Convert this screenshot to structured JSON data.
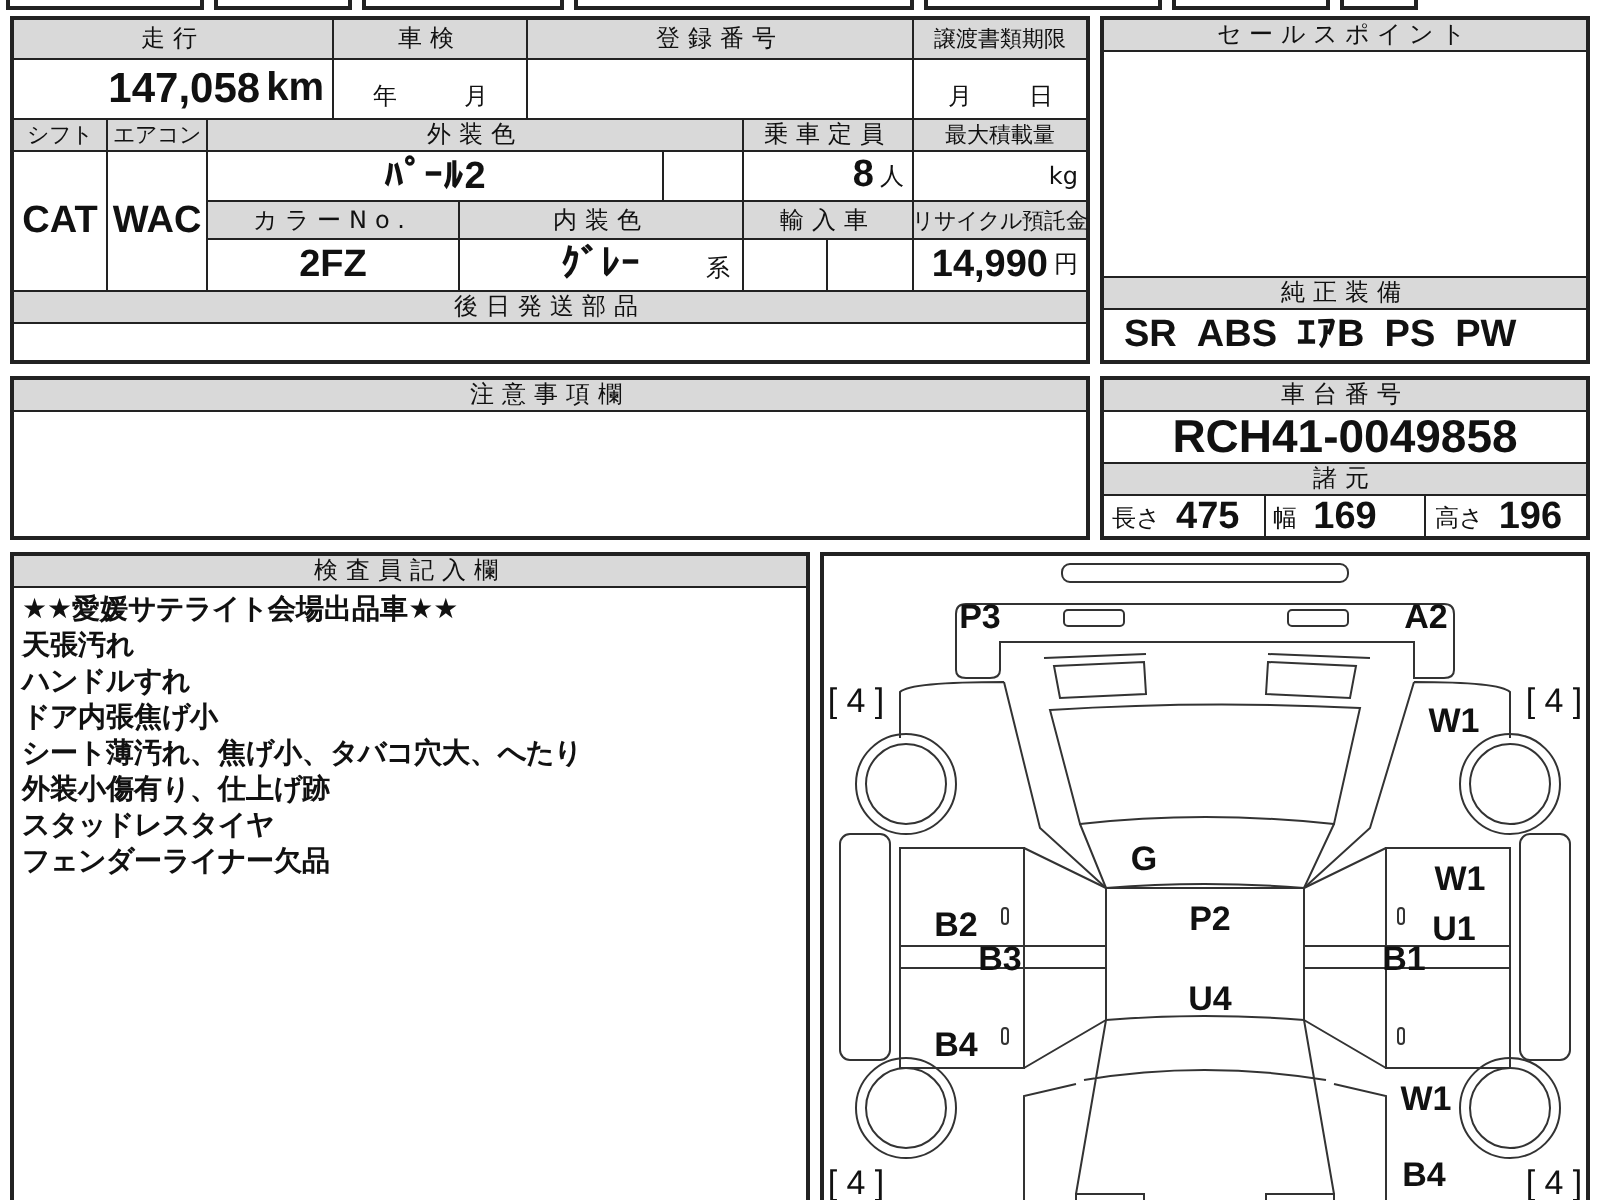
{
  "vehicle_info": {
    "mileage": {
      "label": "走行",
      "value": "147,058",
      "unit": "km"
    },
    "inspection": {
      "label": "車検",
      "year_unit": "年",
      "month_unit": "月"
    },
    "registration_number": {
      "label": "登録番号"
    },
    "transfer_document_deadline": {
      "label": "譲渡書類期限",
      "month_unit": "月",
      "day_unit": "日"
    },
    "shift": {
      "label": "シフト",
      "value": "CAT"
    },
    "air_conditioner": {
      "label": "エアコン",
      "value": "WAC"
    },
    "exterior_color": {
      "label": "外装色",
      "value": "ﾊﾟｰﾙ2"
    },
    "capacity": {
      "label": "乗車定員",
      "value": "8",
      "unit": "人"
    },
    "max_load": {
      "label": "最大積載量",
      "unit": "kg"
    },
    "color_no": {
      "label": "カラーNo.",
      "value": "2FZ"
    },
    "interior_color": {
      "label": "内装色",
      "value": "ｸﾞﾚｰ",
      "suffix": "系"
    },
    "imported": {
      "label": "輸入車"
    },
    "recycling_deposit": {
      "label": "リサイクル預託金",
      "value": "14,990",
      "unit": "円"
    }
  },
  "parts_sent_later": {
    "label": "後日発送部品"
  },
  "sales_points": {
    "label": "セールスポイント"
  },
  "standard_equipment": {
    "label": "純正装備",
    "items": [
      "SR",
      "ABS",
      "ｴｱB",
      "PS",
      "PW"
    ]
  },
  "notes": {
    "label": "注意事項欄"
  },
  "chassis_number": {
    "label": "車台番号",
    "value": "RCH41-0049858"
  },
  "specs": {
    "label": "諸元",
    "items": [
      {
        "label": "長さ",
        "value": "475"
      },
      {
        "label": "幅",
        "value": "169"
      },
      {
        "label": "高さ",
        "value": "196"
      }
    ]
  },
  "inspector_notes": {
    "label": "検査員記入欄",
    "lines": [
      "★★愛媛サテライト会場出品車★★",
      "天張汚れ",
      "ハンドルすれ",
      "ドア内張焦げ小",
      "シート薄汚れ、焦げ小、タバコ穴大、へたり",
      "外装小傷有り、仕上げ跡",
      "スタッドレスタイヤ",
      "フェンダーライナー欠品"
    ]
  },
  "damage_marks": [
    {
      "kind": "code",
      "text": "P3"
    },
    {
      "kind": "code",
      "text": "A2"
    },
    {
      "kind": "tire",
      "text": "[ 4 ]"
    },
    {
      "kind": "tire",
      "text": "[ 4 ]"
    },
    {
      "kind": "code",
      "text": "W1"
    },
    {
      "kind": "code",
      "text": "G"
    },
    {
      "kind": "code",
      "text": "W1"
    },
    {
      "kind": "code",
      "text": "B2"
    },
    {
      "kind": "code",
      "text": "P2"
    },
    {
      "kind": "code",
      "text": "U1"
    },
    {
      "kind": "code",
      "text": "B3"
    },
    {
      "kind": "code",
      "text": "B1"
    },
    {
      "kind": "code",
      "text": "U4"
    },
    {
      "kind": "code",
      "text": "B4"
    },
    {
      "kind": "code",
      "text": "W1"
    },
    {
      "kind": "tire",
      "text": "[ 4 ]"
    },
    {
      "kind": "code",
      "text": "B4"
    },
    {
      "kind": "tire",
      "text": "[ 4 ]"
    }
  ]
}
